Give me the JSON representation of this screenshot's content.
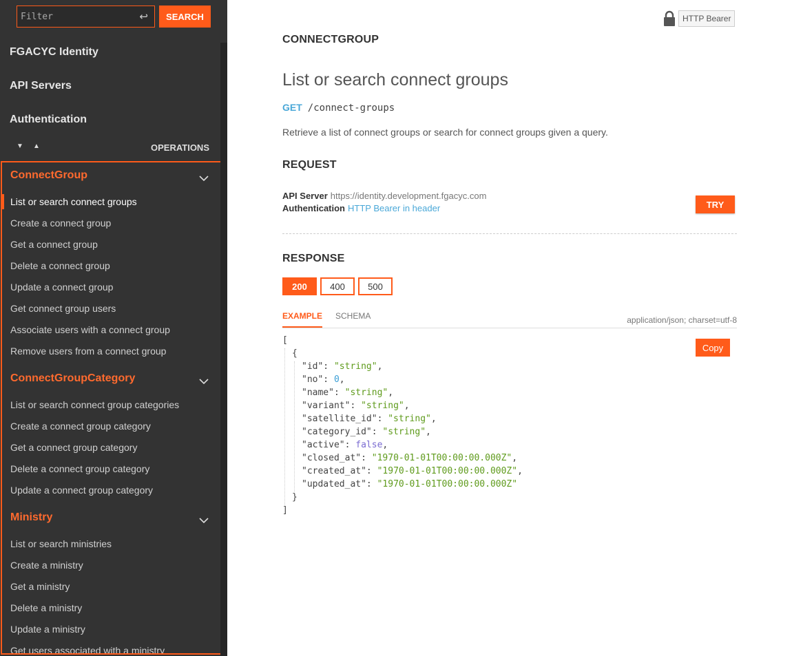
{
  "sidebar": {
    "filter_placeholder": "Filter",
    "search_label": "SEARCH",
    "top_links": [
      "FGACYC Identity",
      "API Servers",
      "Authentication"
    ],
    "operations_label": "OPERATIONS",
    "groups": [
      {
        "title": "ConnectGroup",
        "items": [
          "List or search connect groups",
          "Create a connect group",
          "Get a connect group",
          "Delete a connect group",
          "Update a connect group",
          "Get connect group users",
          "Associate users with a connect group",
          "Remove users from a connect group"
        ]
      },
      {
        "title": "ConnectGroupCategory",
        "items": [
          "List or search connect group categories",
          "Create a connect group category",
          "Get a connect group category",
          "Delete a connect group category",
          "Update a connect group category"
        ]
      },
      {
        "title": "Ministry",
        "items": [
          "List or search ministries",
          "Create a ministry",
          "Get a ministry",
          "Delete a ministry",
          "Update a ministry",
          "Get users associated with a ministry"
        ]
      }
    ]
  },
  "main": {
    "auth_badge": "HTTP Bearer",
    "section": "CONNECTGROUP",
    "title": "List or search connect groups",
    "method": "GET",
    "path": "/connect-groups",
    "description": "Retrieve a list of connect groups or search for connect groups given a query.",
    "request_label": "REQUEST",
    "api_server_key": "API Server",
    "api_server_value": "https://identity.development.fgacyc.com",
    "auth_key": "Authentication",
    "auth_value": "HTTP Bearer in header",
    "try_label": "TRY",
    "response_label": "RESPONSE",
    "status_codes": [
      "200",
      "400",
      "500"
    ],
    "tab_example": "EXAMPLE",
    "tab_schema": "SCHEMA",
    "content_type": "application/json; charset=utf-8",
    "copy_label": "Copy",
    "example_fields": [
      {
        "key": "id",
        "value": "\"string\"",
        "type": "s"
      },
      {
        "key": "no",
        "value": "0",
        "type": "n"
      },
      {
        "key": "name",
        "value": "\"string\"",
        "type": "s"
      },
      {
        "key": "variant",
        "value": "\"string\"",
        "type": "s"
      },
      {
        "key": "satellite_id",
        "value": "\"string\"",
        "type": "s"
      },
      {
        "key": "category_id",
        "value": "\"string\"",
        "type": "s"
      },
      {
        "key": "active",
        "value": "false",
        "type": "b"
      },
      {
        "key": "closed_at",
        "value": "\"1970-01-01T00:00:00.000Z\"",
        "type": "s"
      },
      {
        "key": "created_at",
        "value": "\"1970-01-01T00:00:00.000Z\"",
        "type": "s"
      },
      {
        "key": "updated_at",
        "value": "\"1970-01-01T00:00:00.000Z\"",
        "type": "s"
      }
    ]
  }
}
